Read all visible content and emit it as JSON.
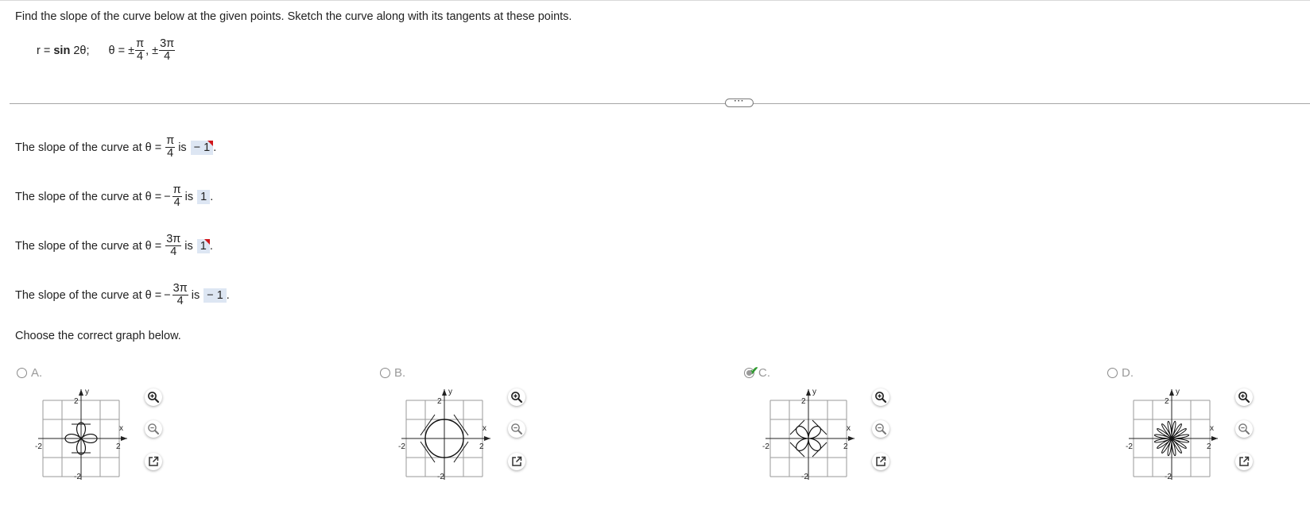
{
  "question": {
    "instruction": "Find the slope of the curve below at the given points. Sketch the curve along with its tangents at these points.",
    "equation_r_label": "r =",
    "equation_func": "sin",
    "equation_arg": "2θ;",
    "theta_label": "θ = ±",
    "pi": "π",
    "three_pi": "3π",
    "four": "4",
    "comma_pm": ", ±"
  },
  "more_button": "···",
  "answers": [
    {
      "prefix": "The slope of the curve at θ =",
      "sign": "",
      "num": "π",
      "den": "4",
      "is": "is",
      "value": "− 1",
      "flag": true
    },
    {
      "prefix": "The slope of the curve at θ =",
      "sign": "−",
      "num": "π",
      "den": "4",
      "is": "is",
      "value": "1",
      "flag": false
    },
    {
      "prefix": "The slope of the curve at θ =",
      "sign": "",
      "num": "3π",
      "den": "4",
      "is": "is",
      "value": "1",
      "flag": true
    },
    {
      "prefix": "The slope of the curve at θ =",
      "sign": "−",
      "num": "3π",
      "den": "4",
      "is": "is",
      "value": "− 1",
      "flag": false
    }
  ],
  "period": ".",
  "choose_prompt": "Choose the correct graph below.",
  "options": [
    {
      "letter": "A.",
      "selected": false,
      "correct": false,
      "curve": "four-petal-axes"
    },
    {
      "letter": "B.",
      "selected": false,
      "correct": false,
      "curve": "circle"
    },
    {
      "letter": "C.",
      "selected": true,
      "correct": true,
      "curve": "four-petal-diagonal"
    },
    {
      "letter": "D.",
      "selected": false,
      "correct": false,
      "curve": "many-petal"
    }
  ],
  "graph_labels": {
    "y": "y",
    "x": "x",
    "pos": "2",
    "neg": "-2"
  },
  "tool_icons": [
    "zoom-in-icon",
    "zoom-out-icon",
    "open-new-window-icon"
  ],
  "colors": {
    "flag": "#d0161b",
    "answer_bg": "#dde6f3",
    "check": "#2f9a2f"
  }
}
